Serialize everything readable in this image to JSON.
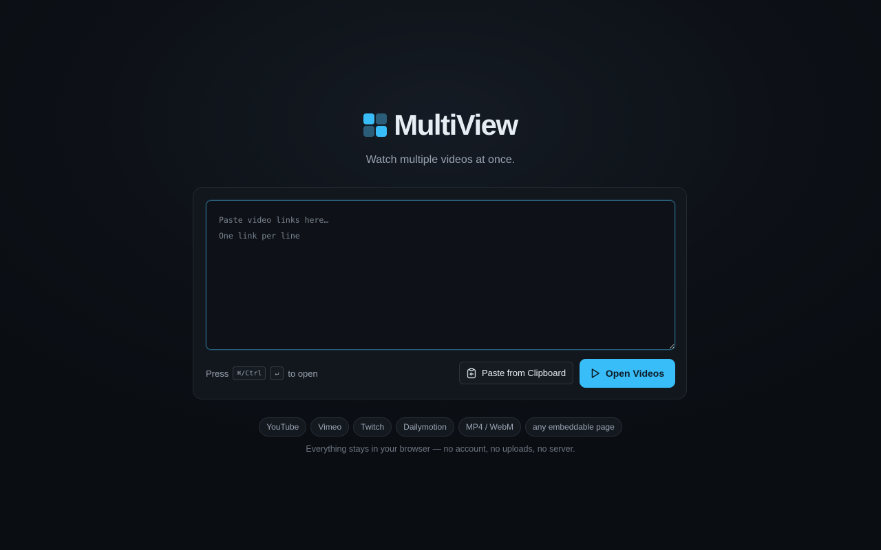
{
  "brand": {
    "title": "MultiView",
    "tagline": "Watch multiple videos at once.",
    "logo_colors": [
      "#38bdf8",
      "#2b5d78",
      "#2b5d78",
      "#38bdf8"
    ]
  },
  "input": {
    "placeholder": "Paste video links here…\nOne link per line",
    "value": ""
  },
  "shortcut": {
    "prefix": "Press",
    "modifier_key": "⌘/Ctrl",
    "enter_key": "↵",
    "suffix": "to open"
  },
  "actions": {
    "paste_label": "Paste from Clipboard",
    "paste_icon": "clipboard-icon",
    "open_label": "Open Videos",
    "open_icon": "play-icon"
  },
  "platforms": [
    "YouTube",
    "Vimeo",
    "Twitch",
    "Dailymotion",
    "MP4 / WebM",
    "any embeddable page"
  ],
  "footnote": "Everything stays in your browser — no account, no uploads, no server.",
  "colors": {
    "accent": "#38bdf8",
    "background": "#0d1117",
    "card": "#12161d"
  }
}
